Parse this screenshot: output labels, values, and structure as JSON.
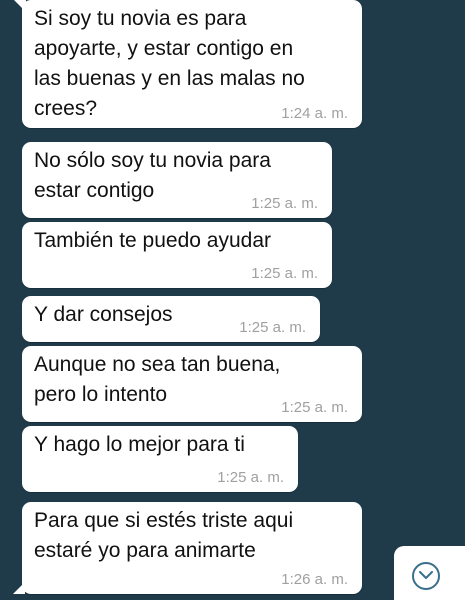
{
  "messages": [
    {
      "text": "Si soy tu novia es para\napoyarte, y estar contigo en\nlas buenas y en las malas no\ncrees?",
      "time": "1:24 a. m."
    },
    {
      "text": "No sólo soy tu novia para\nestar contigo",
      "time": "1:25 a. m."
    },
    {
      "text": "También te puedo ayudar",
      "time": "1:25 a. m."
    },
    {
      "text": "Y dar consejos",
      "time": "1:25 a. m."
    },
    {
      "text": "Aunque no sea tan buena,\npero lo intento",
      "time": "1:25 a. m."
    },
    {
      "text": "Y hago lo mejor para ti",
      "time": "1:25 a. m."
    },
    {
      "text": "Para que si estés triste aqui\nestaré yo para animarte",
      "time": "1:26 a. m."
    }
  ],
  "scroll_button": {
    "icon": "chevron-down-icon"
  },
  "colors": {
    "background": "#1f3b4a",
    "bubble": "#ffffff",
    "time": "#a0a0a0",
    "icon": "#3a6f8c"
  }
}
